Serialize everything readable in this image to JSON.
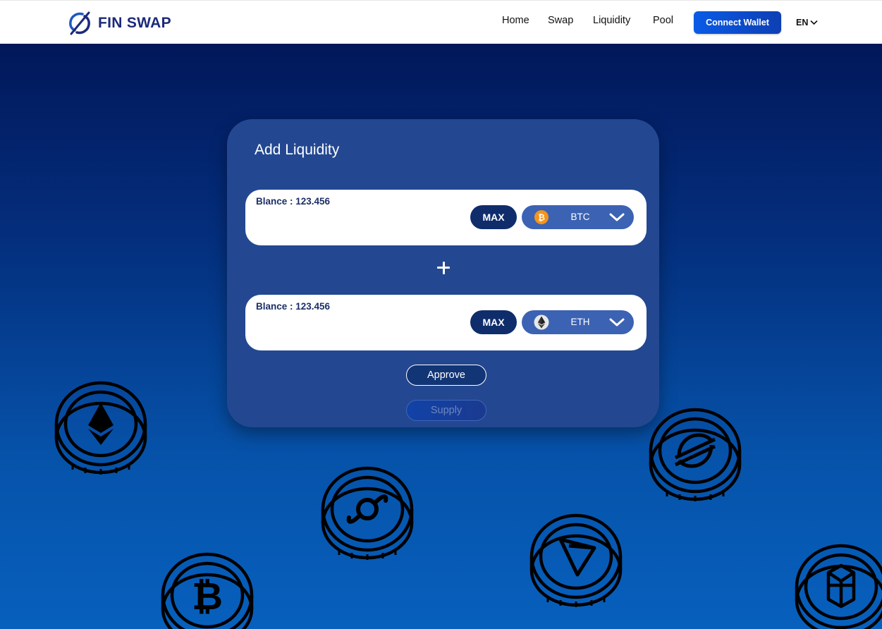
{
  "header": {
    "brand": "FIN SWAP",
    "nav": [
      {
        "label": "Home"
      },
      {
        "label": "Swap"
      },
      {
        "label": "Liquidity"
      },
      {
        "label": "Pool"
      }
    ],
    "connect_wallet": "Connect Wallet",
    "language": "EN"
  },
  "card": {
    "title": "Add Liquidity",
    "token_a": {
      "balance": "Blance : 123.456",
      "max_label": "MAX",
      "symbol": "BTC",
      "icon": "bitcoin-icon"
    },
    "token_b": {
      "balance": "Blance : 123.456",
      "max_label": "MAX",
      "symbol": "ETH",
      "icon": "ethereum-icon"
    },
    "approve_label": "Approve",
    "supply_label": "Supply"
  },
  "decorations": {
    "coins": [
      "ethereum-coin",
      "bitcoin-coin",
      "helium-coin",
      "tron-coin",
      "stellar-coin",
      "fantom-coin"
    ]
  },
  "colors": {
    "brand": "#1b2a7a",
    "accent": "#0a5be6",
    "card": "#234891",
    "token_select": "#3c62b3",
    "max_button": "#0f2d6b"
  }
}
